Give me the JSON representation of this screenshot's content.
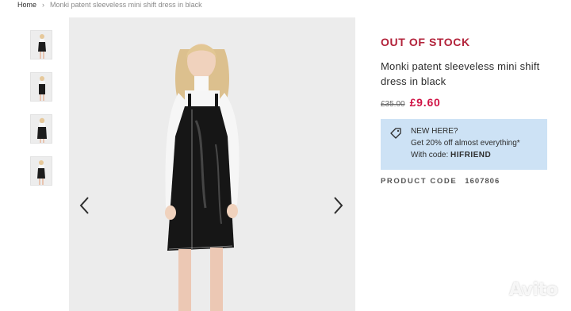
{
  "breadcrumb": {
    "home": "Home",
    "separator": "›",
    "current": "Monki patent sleeveless mini shift dress in black"
  },
  "gallery": {
    "thumbnail_count": 4,
    "prev_icon": "chevron-left-icon",
    "next_icon": "chevron-right-icon"
  },
  "product": {
    "status": "OUT OF STOCK",
    "title": "Monki patent sleeveless mini shift dress in black",
    "old_price": "£35.00",
    "new_price": "£9.60"
  },
  "promo": {
    "icon": "price-tag-icon",
    "line1": "NEW HERE?",
    "line2": "Get 20% off almost everything*",
    "line3_prefix": "With code: ",
    "code": "HIFRIEND"
  },
  "product_code": {
    "label": "PRODUCT CODE",
    "value": "1607806"
  },
  "watermark": {
    "text": "Avito"
  },
  "colors": {
    "status": "#b2223a",
    "sale_price": "#d01345",
    "promo_bg": "#cde2f5"
  }
}
